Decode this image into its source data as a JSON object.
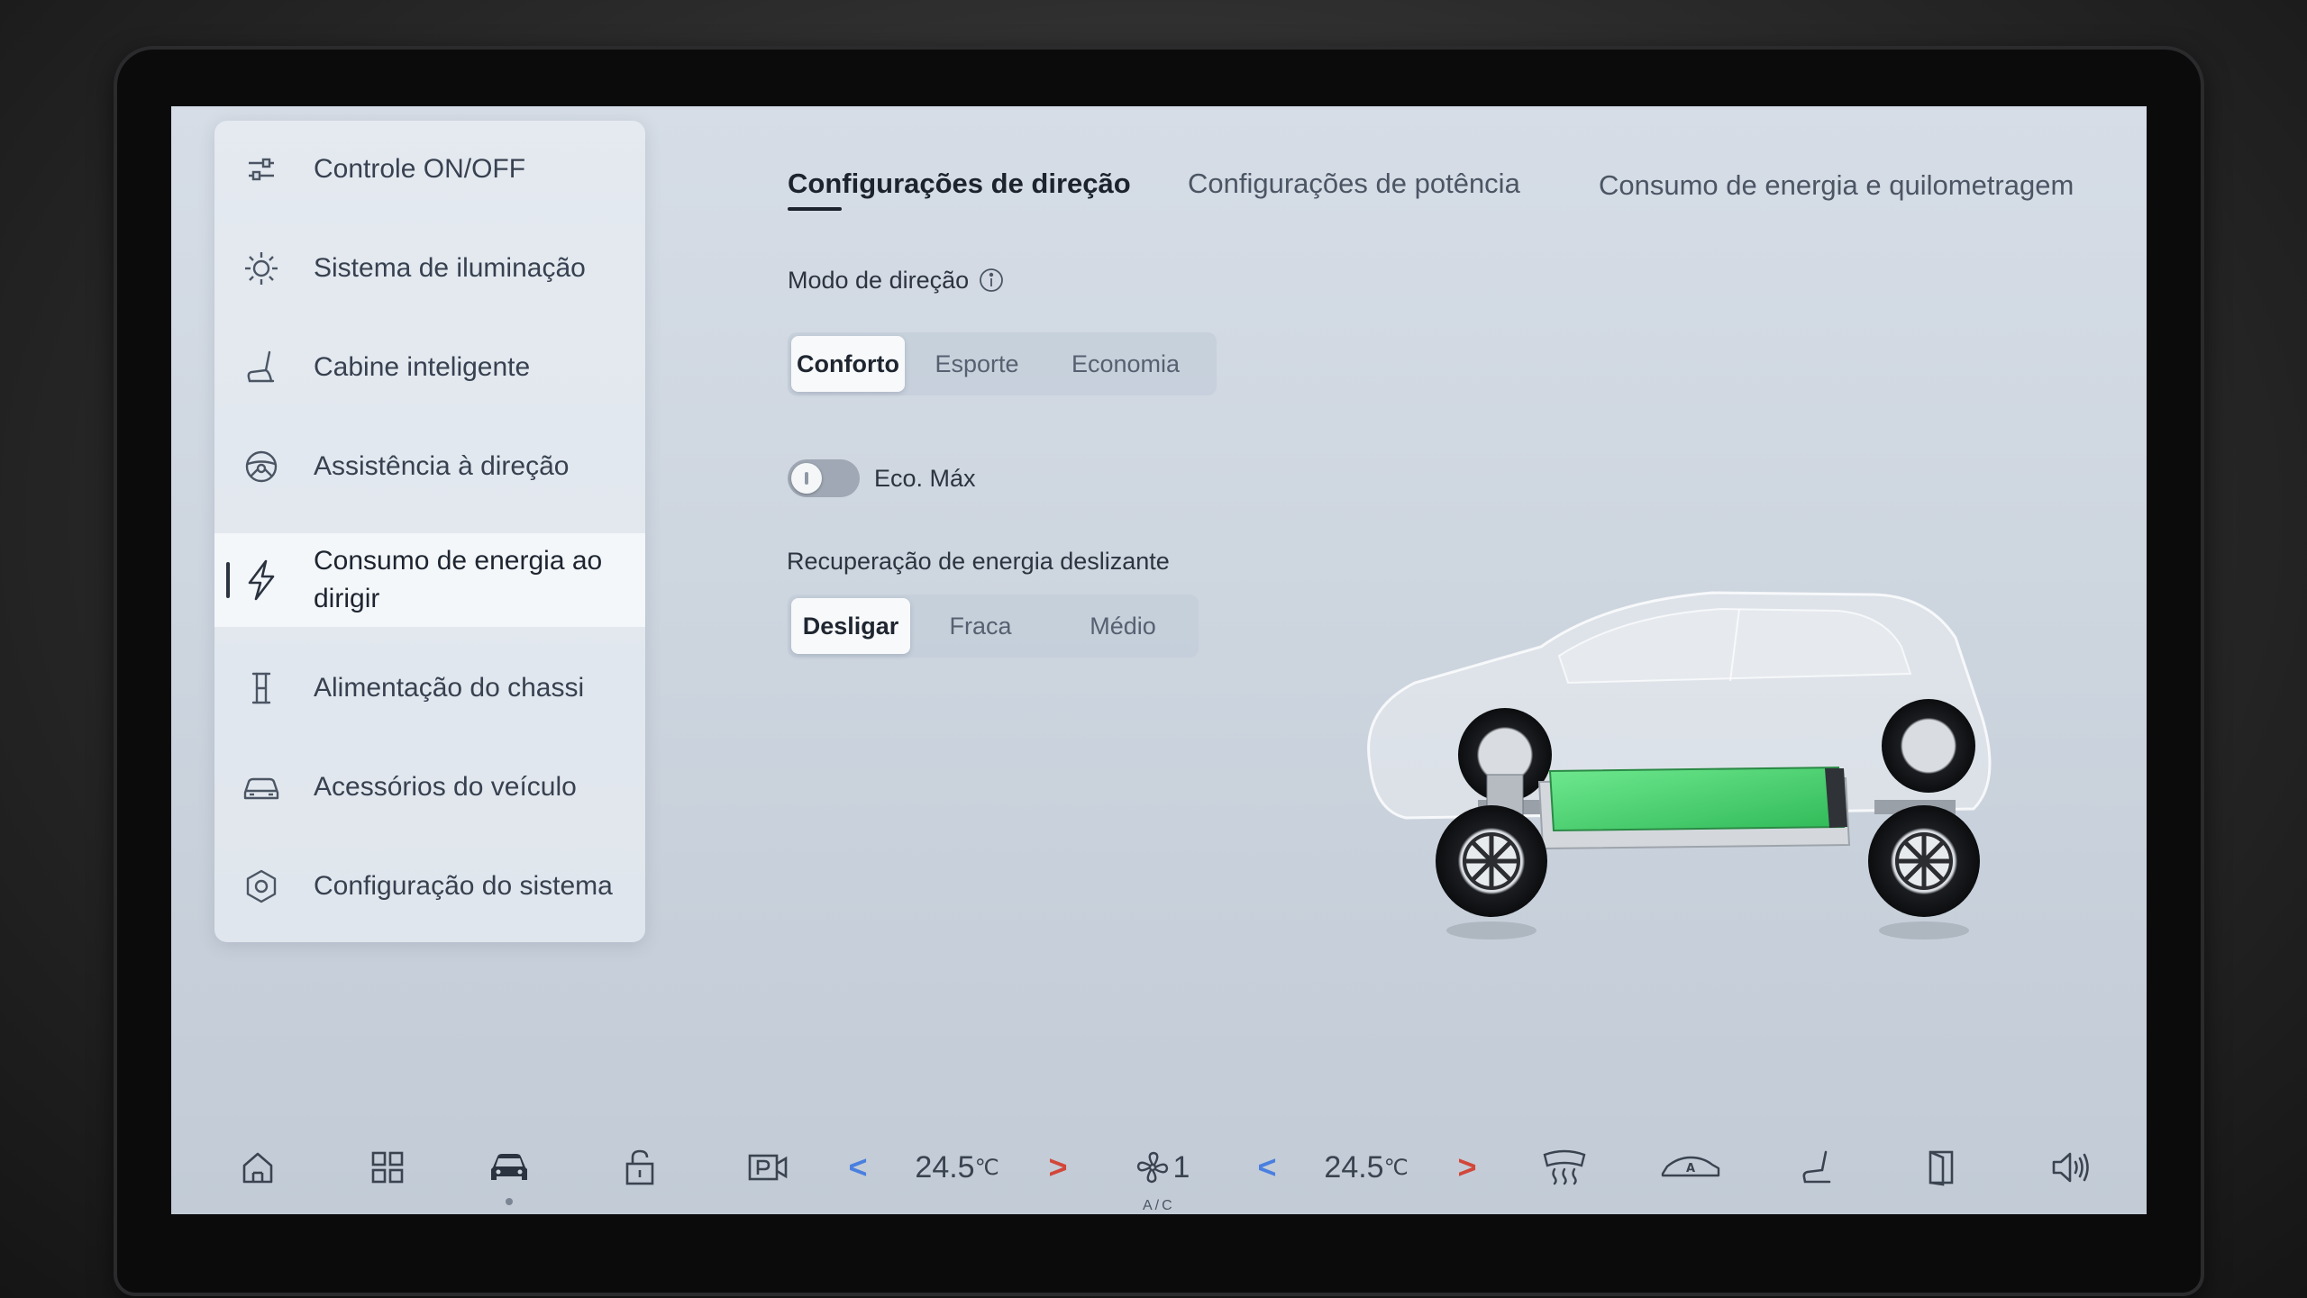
{
  "sidebar": {
    "items": [
      {
        "label": "Controle ON/OFF",
        "icon": "sliders-icon"
      },
      {
        "label": "Sistema de iluminação",
        "icon": "sun-icon"
      },
      {
        "label": "Cabine inteligente",
        "icon": "seat-icon"
      },
      {
        "label": "Assistência à direção",
        "icon": "steering-wheel-icon"
      },
      {
        "label": "Consumo de energia ao",
        "label2": "dirigir",
        "icon": "lightning-icon",
        "active": true
      },
      {
        "label": "Alimentação do chassi",
        "icon": "chassis-icon"
      },
      {
        "label": "Acessórios do veículo",
        "icon": "car-icon"
      },
      {
        "label": "Configuração do sistema",
        "icon": "hexagon-gear-icon"
      }
    ]
  },
  "tabs": [
    {
      "label": "Configurações de direção",
      "active": true
    },
    {
      "label": "Configurações de potência"
    },
    {
      "label": "Consumo de energia e quilometragem"
    }
  ],
  "drive_mode": {
    "label": "Modo de direção",
    "options": [
      "Conforto",
      "Esporte",
      "Economia"
    ],
    "selected": "Conforto"
  },
  "eco_max": {
    "label": "Eco. Máx",
    "on": false
  },
  "regen": {
    "label": "Recuperação de energia deslizante",
    "options": [
      "Desligar",
      "Fraca",
      "Médio"
    ],
    "selected": "Desligar"
  },
  "dock": {
    "left_temp": "24.5",
    "right_temp": "24.5",
    "temp_unit": "℃",
    "fan_level": "1",
    "ac_label": "A/C",
    "left_arrow": "<",
    "right_arrow": ">"
  },
  "colors": {
    "battery": "#3fd36a",
    "accent_blue": "#4a7fe0",
    "accent_red": "#d2473a"
  }
}
